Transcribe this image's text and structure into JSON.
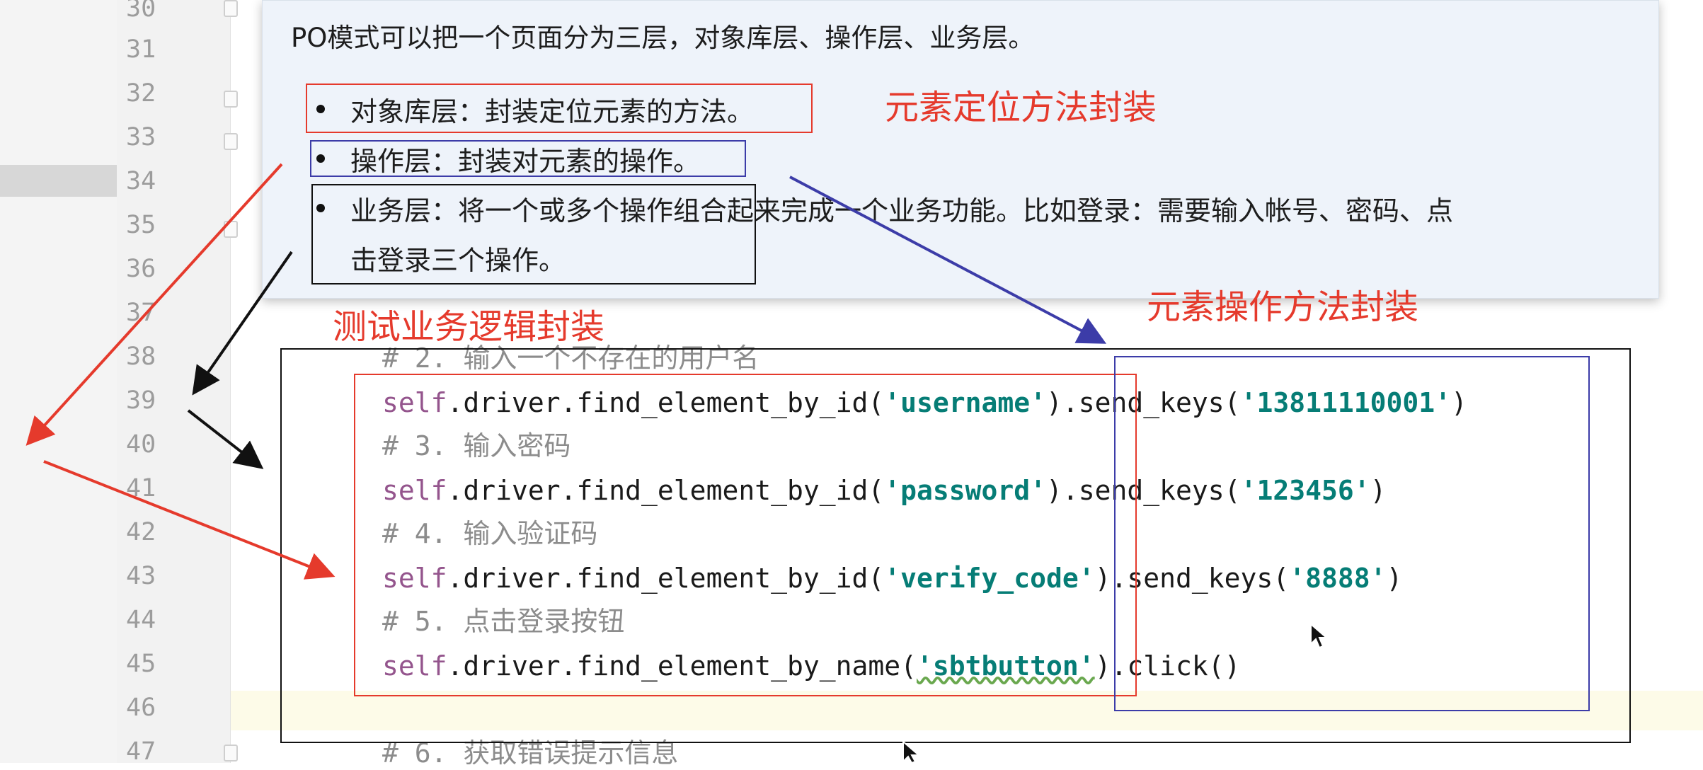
{
  "editor": {
    "line_numbers": [
      "30",
      "31",
      "32",
      "33",
      "34",
      "35",
      "36",
      "37",
      "38",
      "39",
      "40",
      "41",
      "42",
      "43",
      "44",
      "45",
      "46",
      "47"
    ],
    "lines": {
      "l38": "# 2. 输入一个不存在的用户名",
      "l39_a": ".driver.find_element_by_id(",
      "l39_s1": "'username'",
      "l39_b": ").send_keys(",
      "l39_s2": "'13811110001'",
      "l39_c": ")",
      "l40": "# 3. 输入密码",
      "l41_a": ".driver.find_element_by_id(",
      "l41_s1": "'password'",
      "l41_b": ").send_keys(",
      "l41_s2": "'123456'",
      "l41_c": ")",
      "l42": "# 4. 输入验证码",
      "l43_a": ".driver.find_element_by_id(",
      "l43_s1": "'verify_code'",
      "l43_b": ").send_keys(",
      "l43_s2": "'8888'",
      "l43_c": ")",
      "l44": "# 5. 点击登录按钮",
      "l45_a": ".driver.find_element_by_name(",
      "l45_s1": "'sbtbutton'",
      "l45_b": ").click()",
      "l47": "# 6. 获取错误提示信息",
      "self_kw": "self"
    }
  },
  "popup": {
    "intro": "PO模式可以把一个页面分为三层，对象库层、操作层、业务层。",
    "bullets": [
      "对象库层：封装定位元素的方法。",
      "操作层：封装对元素的操作。",
      "业务层：将一个或多个操作组合起来完成一个业务功能。比如登录：需要输入帐号、密码、点",
      "击登录三个操作。"
    ]
  },
  "annotations": {
    "locate": "元素定位方法封装",
    "operate": "元素操作方法封装",
    "business": "测试业务逻辑封装"
  },
  "colors": {
    "red": "#e53a2c",
    "blue": "#3c3ca8",
    "black": "#111111",
    "string_teal": "#067d76",
    "self_purple": "#94558d"
  }
}
